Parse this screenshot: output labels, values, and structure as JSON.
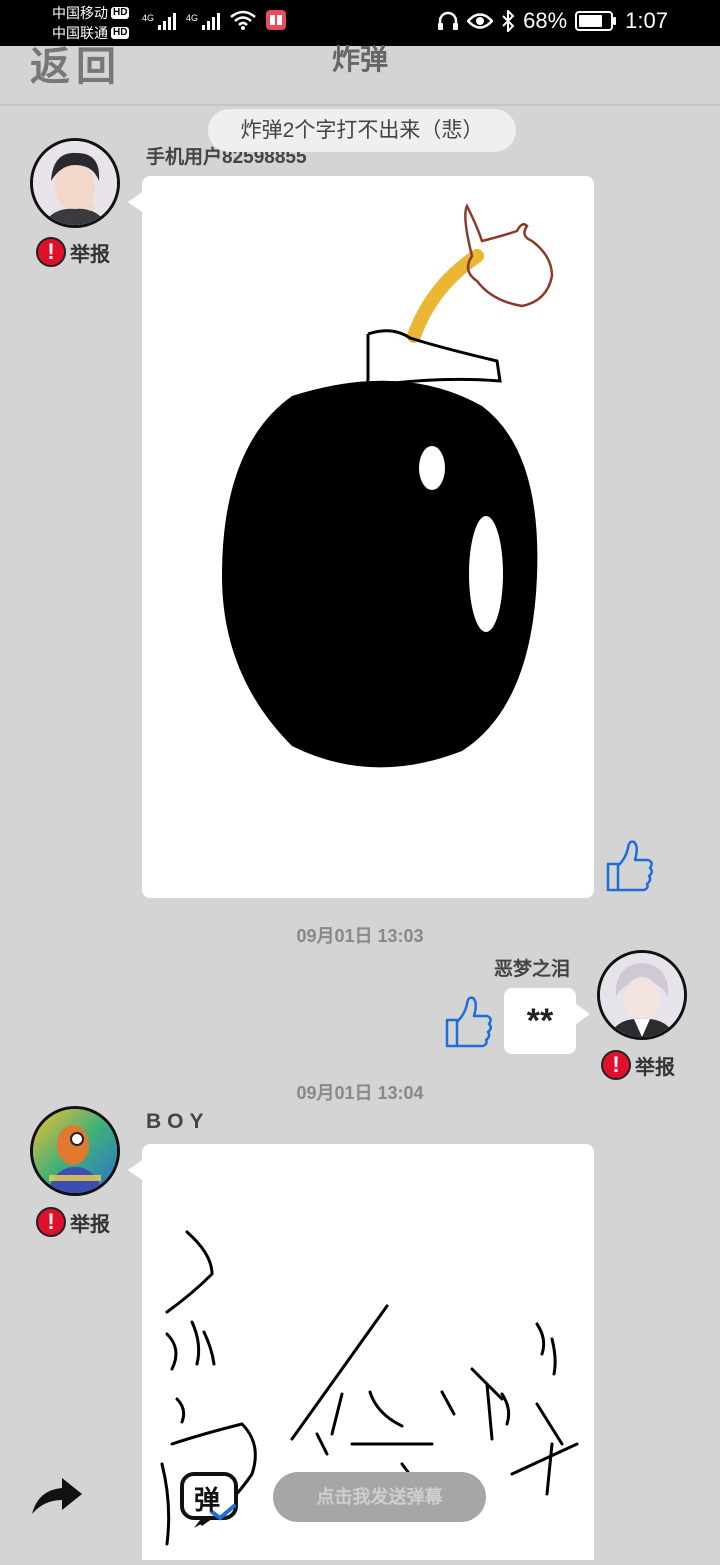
{
  "status_bar": {
    "carrier1": "中国移动",
    "carrier2": "中国联通",
    "hd_badge": "HD",
    "network1": "4G",
    "network2": "4G",
    "battery": "68%",
    "battery_level": 0.68,
    "time": "1:07"
  },
  "header": {
    "back_label": "返回",
    "title": "炸弹"
  },
  "toast": "炸弹2个字打不出来（悲）",
  "messages": [
    {
      "username": "手机用户82598855",
      "report_label": "举报",
      "content_type": "drawing-bomb",
      "side": "left"
    },
    {
      "timestamp": "09月01日  13:03",
      "username": "恶梦之泪",
      "report_label": "举报",
      "text": "**",
      "side": "right"
    },
    {
      "timestamp": "09月01日  13:04",
      "username": "BOY",
      "report_label": "举报",
      "content_type": "drawing-sketch",
      "side": "left"
    }
  ],
  "bottom_bar": {
    "danmu_badge": "弹",
    "danmu_placeholder": "点击我发送弹幕"
  },
  "colors": {
    "background": "#d4d4d4",
    "report_red": "#e0102a",
    "like_blue": "#1a6fd8",
    "fuse_yellow": "#eab735"
  },
  "icons": [
    "like-icon",
    "report-icon",
    "share-icon",
    "danmu-icon"
  ]
}
